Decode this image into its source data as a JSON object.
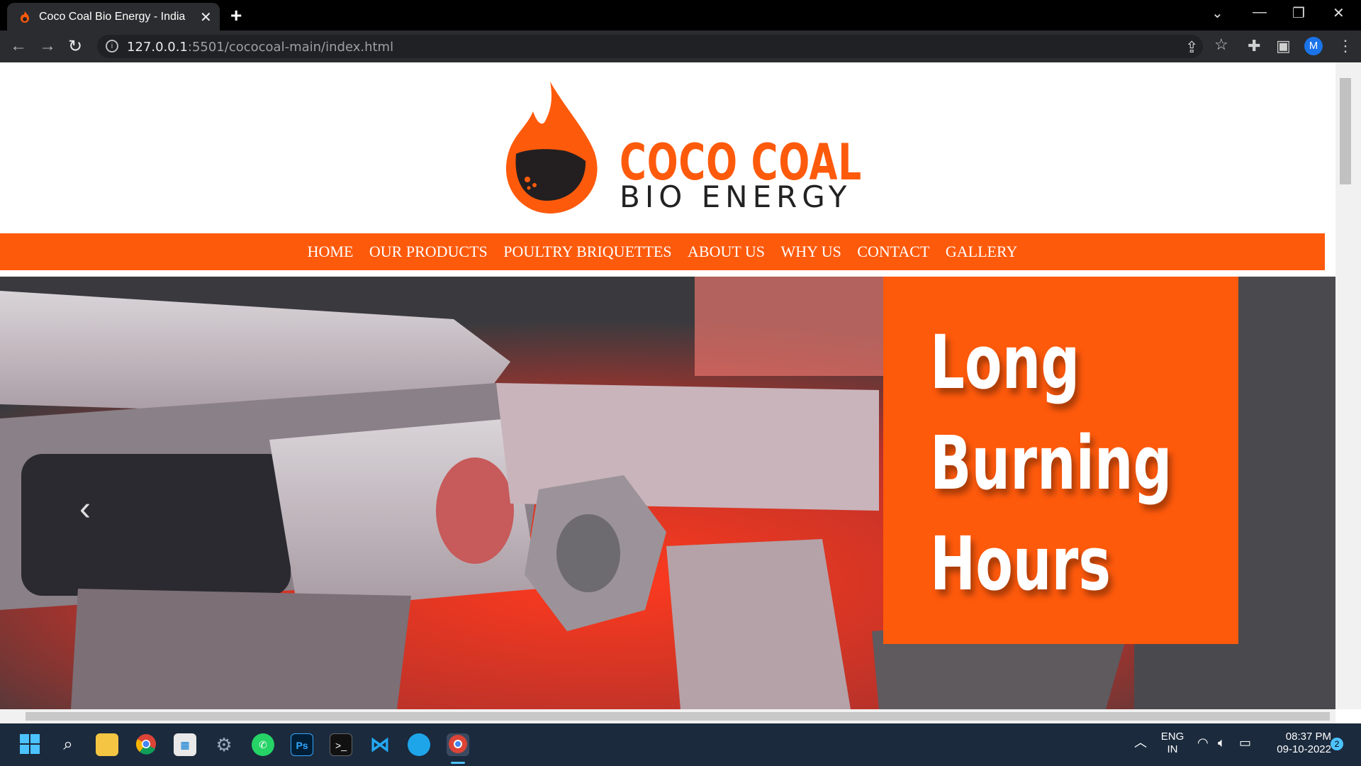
{
  "browser": {
    "tab_title": "Coco Coal Bio Energy - India",
    "url_host": "127.0.0.1",
    "url_rest": ":5501/cococoal-main/index.html",
    "profile_initial": "M"
  },
  "site": {
    "brand_line1": "COCO COAL",
    "brand_line2": "BIO ENERGY",
    "nav": [
      "HOME",
      "OUR PRODUCTS",
      "POULTRY BRIQUETTES",
      "ABOUT US",
      "WHY US",
      "CONTACT",
      "GALLERY"
    ],
    "slide": {
      "line1": "Long",
      "line2": "Burning",
      "line3": "Hours"
    },
    "accent_color": "#fe5a0c"
  },
  "taskbar": {
    "lang1": "ENG",
    "lang2": "IN",
    "time": "08:37 PM",
    "date": "09-10-2022",
    "notifications": "2",
    "apps": [
      "windows-start",
      "search",
      "file-explorer",
      "chrome",
      "store",
      "settings",
      "whatsapp",
      "photoshop",
      "terminal",
      "vscode",
      "edge",
      "chrome-profile"
    ]
  }
}
